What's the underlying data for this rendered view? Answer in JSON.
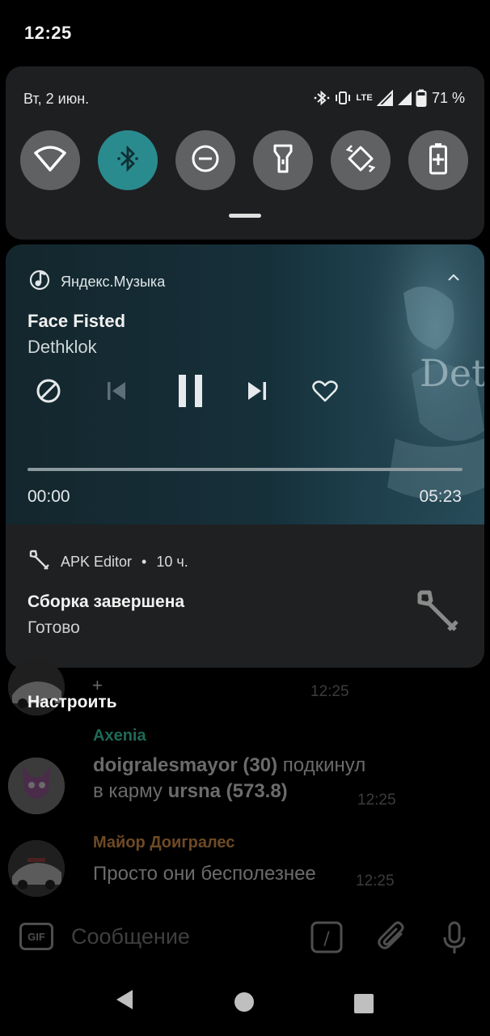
{
  "statusbar": {
    "time": "12:25"
  },
  "quick_settings": {
    "date": "Вт, 2 июн.",
    "network": "LTE",
    "battery": "71 %",
    "tiles": [
      {
        "name": "wifi",
        "active": false
      },
      {
        "name": "bluetooth",
        "active": true
      },
      {
        "name": "do-not-disturb",
        "active": false
      },
      {
        "name": "flashlight",
        "active": false
      },
      {
        "name": "auto-rotate",
        "active": false
      },
      {
        "name": "battery-saver",
        "active": false
      }
    ]
  },
  "media": {
    "app": "Яндекс.Музыка",
    "title": "Face Fisted",
    "artist": "Dethklok",
    "time_current": "00:00",
    "time_total": "05:23",
    "progress": 0
  },
  "apk_notification": {
    "app": "APK Editor",
    "age": "10 ч.",
    "separator": "•",
    "title": "Сборка завершена",
    "text": "Готово"
  },
  "customize_label": "Настроить",
  "chat": {
    "top_plus": "+",
    "top_time": "12:25",
    "msg1": {
      "author": "Axenia",
      "user": "doigralesmayor",
      "user_karma": "(30)",
      "verb": "подкинул",
      "line2_prefix": "в карму",
      "target": "ursna",
      "target_karma": "(573.8)",
      "time": "12:25"
    },
    "msg2": {
      "author": "Майор Доигралес",
      "text": "Просто они бесполезнее",
      "time": "12:25"
    }
  },
  "input": {
    "gif_label": "GIF",
    "placeholder": "Сообщение",
    "command_label": "/"
  }
}
